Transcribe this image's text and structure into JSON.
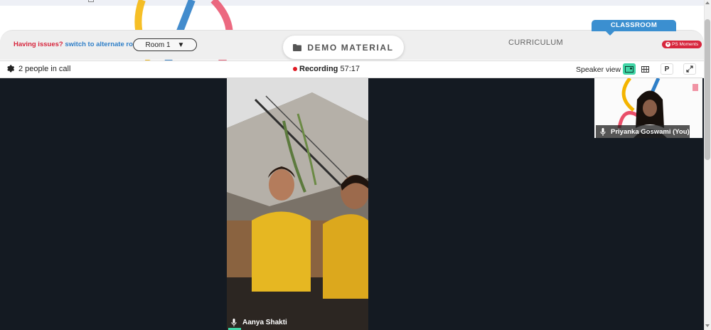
{
  "header": {
    "issues_text": "Having issues?",
    "switch_link": "switch to alternate room",
    "room_selected": "Room 1",
    "room_caret": "▼",
    "demo_material": "DEMO MATERIAL",
    "curriculum": "CURRICULUM",
    "classroom": "CLASSROOM",
    "ps_moments": "PS Moments"
  },
  "call_bar": {
    "people_count": "2 people in call",
    "recording_label": "Recording",
    "recording_time": "57:17",
    "speaker_view_label": "Speaker view",
    "p_button": "P"
  },
  "participants": {
    "main_name": "Aanya Shakti",
    "self_name": "Priyanka Goswami (You)"
  },
  "colors": {
    "accent_green": "#40d5a6",
    "classroom_blue": "#3b8fd0",
    "alert_red": "#d7263d",
    "stage_dark": "#141a22"
  },
  "icons": [
    "gear-icon",
    "record-dot-icon",
    "speaker-layout-icon",
    "grid-layout-icon",
    "fullscreen-icon",
    "folder-icon",
    "mic-icon"
  ]
}
